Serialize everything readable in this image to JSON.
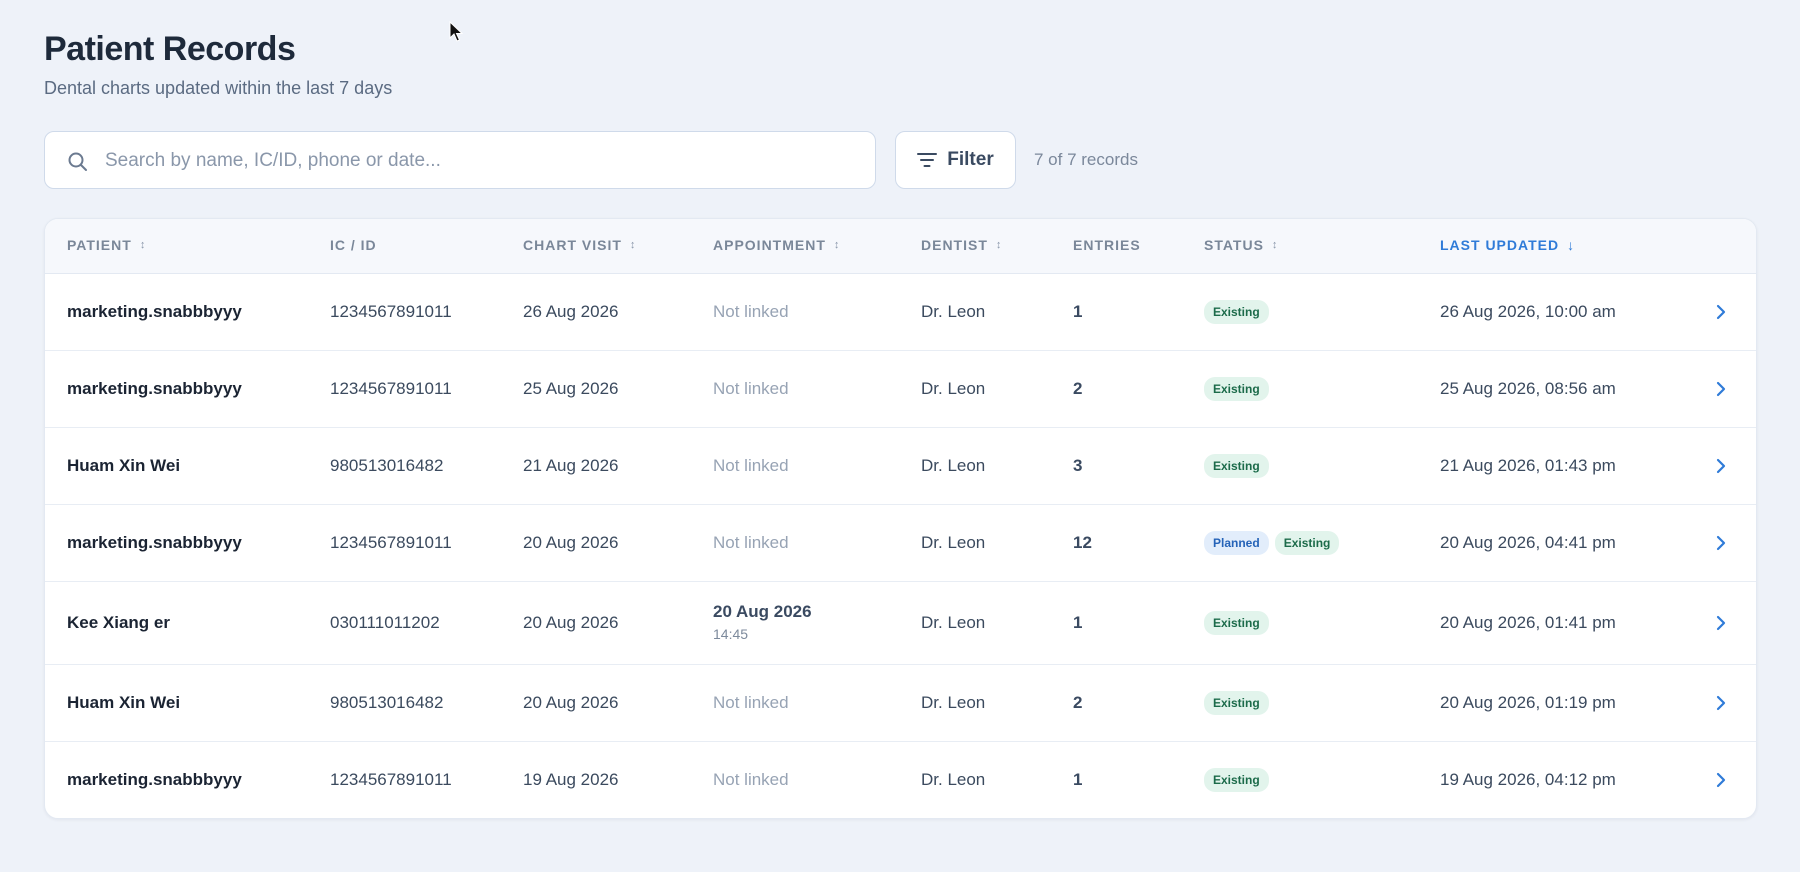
{
  "header": {
    "title": "Patient Records",
    "subtitle": "Dental charts updated within the last 7 days"
  },
  "toolbar": {
    "search_placeholder": "Search by name, IC/ID, phone or date...",
    "search_value": "",
    "filter_label": "Filter",
    "record_count": "7 of 7 records"
  },
  "table": {
    "columns": {
      "patient": "PATIENT",
      "ic": "IC / ID",
      "chart_visit": "CHART VISIT",
      "appointment": "APPOINTMENT",
      "dentist": "DENTIST",
      "entries": "ENTRIES",
      "status": "STATUS",
      "last_updated": "LAST UPDATED"
    },
    "rows": [
      {
        "patient": "marketing.snabbbyyy",
        "ic": "1234567891011",
        "chart_visit": "26 Aug 2026",
        "appointment": "Not linked",
        "appointment_time": "",
        "dentist": "Dr. Leon",
        "entries": "1",
        "status": [
          "Existing"
        ],
        "last_updated": "26 Aug 2026, 10:00 am"
      },
      {
        "patient": "marketing.snabbbyyy",
        "ic": "1234567891011",
        "chart_visit": "25 Aug 2026",
        "appointment": "Not linked",
        "appointment_time": "",
        "dentist": "Dr. Leon",
        "entries": "2",
        "status": [
          "Existing"
        ],
        "last_updated": "25 Aug 2026, 08:56 am"
      },
      {
        "patient": "Huam Xin Wei",
        "ic": "980513016482",
        "chart_visit": "21 Aug 2026",
        "appointment": "Not linked",
        "appointment_time": "",
        "dentist": "Dr. Leon",
        "entries": "3",
        "status": [
          "Existing"
        ],
        "last_updated": "21 Aug 2026, 01:43 pm"
      },
      {
        "patient": "marketing.snabbbyyy",
        "ic": "1234567891011",
        "chart_visit": "20 Aug 2026",
        "appointment": "Not linked",
        "appointment_time": "",
        "dentist": "Dr. Leon",
        "entries": "12",
        "status": [
          "Planned",
          "Existing"
        ],
        "last_updated": "20 Aug 2026, 04:41 pm"
      },
      {
        "patient": "Kee Xiang er",
        "ic": "030111011202",
        "chart_visit": "20 Aug 2026",
        "appointment": "20 Aug 2026",
        "appointment_time": "14:45",
        "dentist": "Dr. Leon",
        "entries": "1",
        "status": [
          "Existing"
        ],
        "last_updated": "20 Aug 2026, 01:41 pm"
      },
      {
        "patient": "Huam Xin Wei",
        "ic": "980513016482",
        "chart_visit": "20 Aug 2026",
        "appointment": "Not linked",
        "appointment_time": "",
        "dentist": "Dr. Leon",
        "entries": "2",
        "status": [
          "Existing"
        ],
        "last_updated": "20 Aug 2026, 01:19 pm"
      },
      {
        "patient": "marketing.snabbbyyy",
        "ic": "1234567891011",
        "chart_visit": "19 Aug 2026",
        "appointment": "Not linked",
        "appointment_time": "",
        "dentist": "Dr. Leon",
        "entries": "1",
        "status": [
          "Existing"
        ],
        "last_updated": "19 Aug 2026, 04:12 pm"
      }
    ]
  },
  "icons": {
    "search": "search-icon",
    "filter": "filter-icon",
    "sort": "sort-icon",
    "sort_desc": "arrow-down-icon",
    "row_action": "chevron-right-icon"
  },
  "colors": {
    "accent": "#2f7bd8",
    "existing_badge_bg": "#e2f4ec",
    "existing_badge_text": "#1c6b4a",
    "planned_badge_bg": "#e2edfb",
    "planned_badge_text": "#2563b8"
  }
}
